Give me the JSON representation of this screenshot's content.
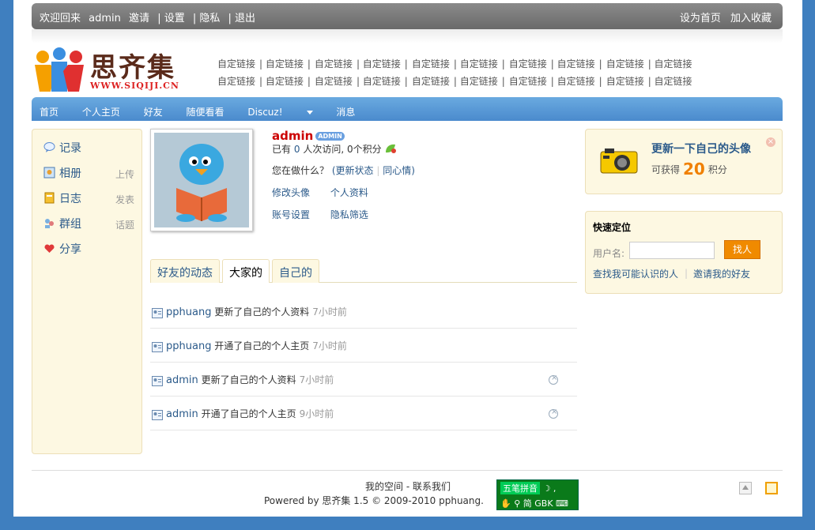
{
  "topbar": {
    "welcome": "欢迎回来",
    "username": "admin",
    "invite": "邀请",
    "settings": "| 设置",
    "privacy": "| 隐私",
    "logout": "| 退出",
    "set_home": "设为首页",
    "bookmark": "加入收藏"
  },
  "logo": {
    "brand": "思齐集",
    "url": "WWW.SIQIJI.CN"
  },
  "custom_links": {
    "row1": [
      "自定链接",
      "| 自定链接",
      "| ",
      "自定链接",
      "| 自定链接",
      "| ",
      "自定链接",
      "| 自定链接",
      "| ",
      "自定链接",
      "| 自定链接",
      "| ",
      "自定链接",
      "| 自定链接"
    ],
    "row2": [
      "自定链接",
      "| 自定链接",
      "| ",
      "自定链接",
      "| 自定链接",
      "| ",
      "自定链接",
      "| 自定链接",
      "| ",
      "自定链接",
      "| 自定链接",
      "| ",
      "自定链接",
      "| 自定链接"
    ]
  },
  "nav": {
    "home": "首页",
    "personal": "个人主页",
    "friends": "好友",
    "browse": "随便看看",
    "discuz": "Discuz!",
    "messages": "消息"
  },
  "sidebar": {
    "record": "记录",
    "album": "相册",
    "album_sub": "上传",
    "blog": "日志",
    "blog_sub": "发表",
    "group": "群组",
    "group_sub": "话题",
    "share": "分享"
  },
  "profile": {
    "name": "admin",
    "badge": "ADMIN",
    "has": "已有",
    "visits": "0",
    "visits_label": "人次访问,",
    "points": "0",
    "points_label": "个积分",
    "doing": "您在做什么？",
    "update_status": "(更新状态",
    "mood": "同心情)",
    "edit_avatar": "修改头像",
    "profile_info": "个人资料",
    "account_settings": "账号设置",
    "privacy_filter": "隐私筛选"
  },
  "tabs": {
    "friends_feed": "好友的动态",
    "everyone": "大家的",
    "mine": "自己的"
  },
  "feed": [
    {
      "user": "pphuang",
      "action": "更新了自己的个人资料",
      "time": "7小时前"
    },
    {
      "user": "pphuang",
      "action": "开通了自己的个人主页",
      "time": "7小时前"
    },
    {
      "user": "admin",
      "action": "更新了自己的个人资料",
      "time": "7小时前"
    },
    {
      "user": "admin",
      "action": "开通了自己的个人主页",
      "time": "9小时前"
    }
  ],
  "avatar_box": {
    "title": "更新一下自己的头像",
    "earn": "可获得",
    "points": "20",
    "points_unit": "积分"
  },
  "locate": {
    "title": "快速定位",
    "username_label": "用户名:",
    "search_btn": "找人",
    "find_known": "查找我可能认识的人",
    "invite_friends": "邀请我的好友"
  },
  "footer": {
    "line1": "我的空间  - 联系我们",
    "line2": "Powered by 思齐集  1.5 © 2009-2010 pphuang."
  },
  "ime": {
    "row1": "五笔拼音",
    "row2": "简 GBK"
  },
  "colors": {
    "brand_blue": "#3f7fbf",
    "link": "#2b5a8a",
    "accent_orange": "#f08a00",
    "admin_red": "#c00"
  }
}
